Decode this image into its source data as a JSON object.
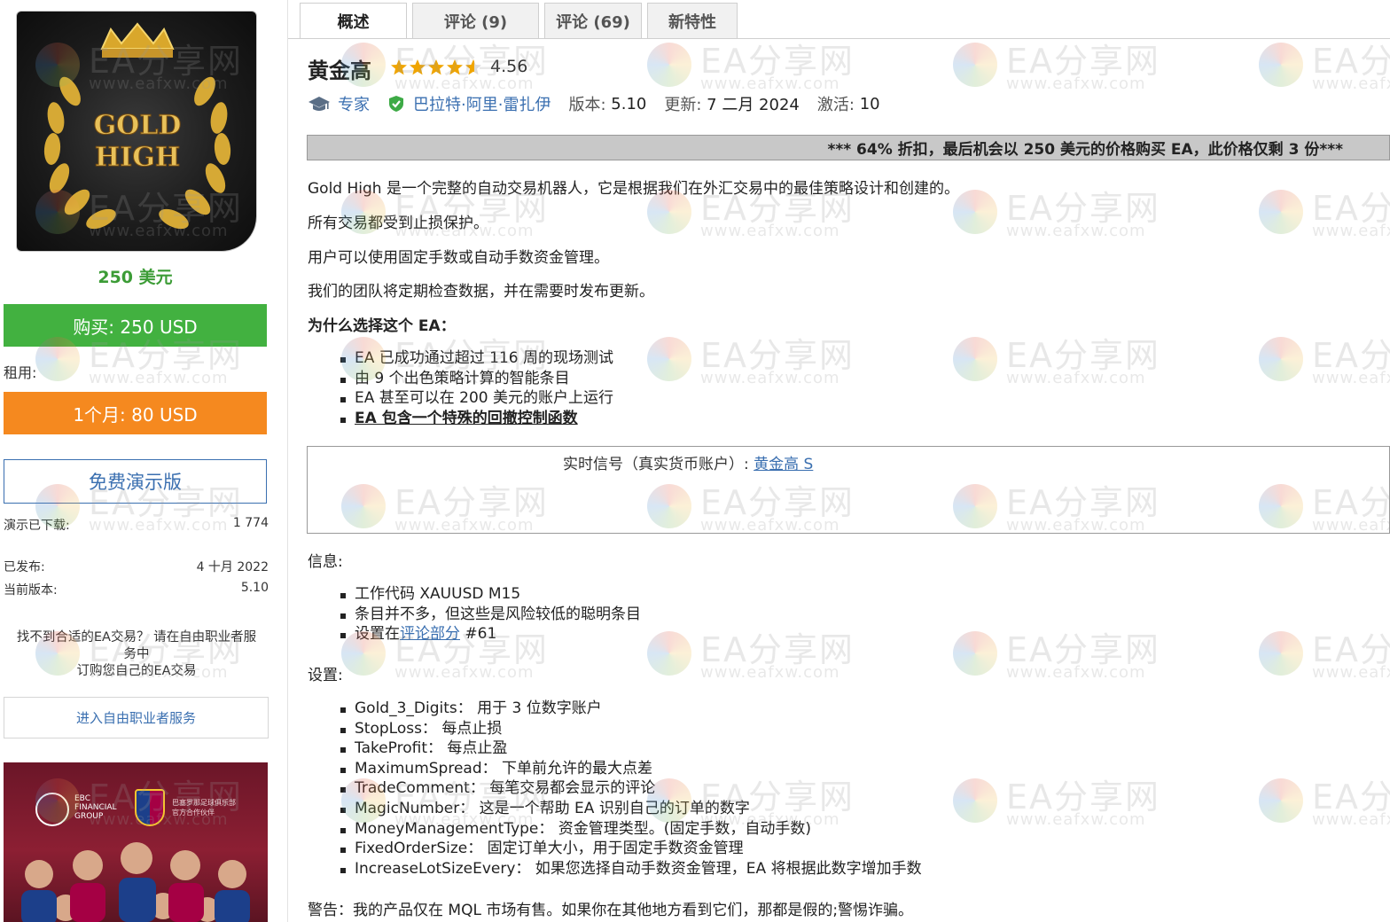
{
  "left": {
    "image_text": [
      "GOLD",
      "HIGH"
    ],
    "price": "250 美元",
    "buy_label": "购买: 250 USD",
    "rent_label": "租用:",
    "rent_button": "1个月: 80 USD",
    "demo_button": "免费演示版",
    "demo_downloads_label": "演示已下载:",
    "demo_downloads_value": "1 774",
    "published_label": "已发布:",
    "published_value": "4 十月 2022",
    "version_label": "当前版本:",
    "version_value": "5.10",
    "freelance_text_1": "找不到合适的EA交易？ 请在自由职业者服",
    "freelance_text_2": "务中",
    "freelance_text_3": "订购您自己的EA交易",
    "freelance_button": "进入自由职业者服务",
    "banner": {
      "ebc_lines": [
        "EBC",
        "FINANCIAL",
        "GROUP"
      ],
      "fcb_lines": [
        "巴塞罗那足球俱乐部",
        "官方合作伙伴"
      ]
    }
  },
  "tabs": [
    {
      "label": "概述",
      "active": true
    },
    {
      "label": "评论 (9)",
      "active": false
    },
    {
      "label": "评论 (69)",
      "active": false
    },
    {
      "label": "新特性",
      "active": false
    }
  ],
  "product": {
    "title": "黄金高",
    "rating": "4.56",
    "rating_value": 4.56,
    "category": "专家",
    "author": "巴拉特·阿里·雷扎伊",
    "version_label": "版本:",
    "version": "5.10",
    "updated_label": "更新:",
    "updated": "7 二月 2024",
    "activations_label": "激活:",
    "activations": "10"
  },
  "promo": "*** 64% 折扣，最后机会以 250 美元的价格购买 EA，此价格仅剩 3 份***",
  "description": {
    "p1": "Gold High 是一个完整的自动交易机器人，它是根据我们在外汇交易中的最佳策略设计和创建的。",
    "p2": "所有交易都受到止损保护。",
    "p3": "用户可以使用固定手数或自动手数资金管理。",
    "p4": "我们的团队将定期检查数据，并在需要时发布更新。",
    "why_heading": "为什么选择这个 EA：",
    "why_items": [
      "EA 已成功通过超过 116 周的现场测试",
      "由 9 个出色策略计算的智能条目",
      "EA 甚至可以在 200 美元的账户上运行",
      "EA 包含一个特殊的回撤控制函数"
    ],
    "signal_label": "实时信号（真实货币账户）:",
    "signal_link": "黄金高 S",
    "info_heading": "信息:",
    "info_items": [
      "工作代码 XAUUSD M15",
      "条目并不多，但这些是风险较低的聪明条目"
    ],
    "info_item3_prefix": "设置在",
    "info_item3_link": "评论部分",
    "info_item3_suffix": " #61",
    "settings_heading": "设置:",
    "settings": [
      "Gold_3_Digits： 用于 3 位数字账户",
      "StopLoss： 每点止损",
      "TakeProfit： 每点止盈",
      "MaximumSpread： 下单前允许的最大点差",
      "TradeComment： 每笔交易都会显示的评论",
      "MagicNumber： 这是一个帮助 EA 识别自己的订单的数字",
      "MoneyManagementType： 资金管理类型。(固定手数，自动手数)",
      "FixedOrderSize： 固定订单大小，用于固定手数资金管理",
      "IncreaseLotSizeEvery： 如果您选择自动手数资金管理，EA 将根据此数字增加手数"
    ],
    "warning": "警告：我的产品仅在 MQL 市场有售。如果你在其他地方看到它们，那都是假的;警惕诈骗。"
  },
  "watermark": {
    "cn": "EA分享网",
    "url": "www.eafxw.com"
  },
  "colors": {
    "buy": "#42b140",
    "rent": "#f5891f",
    "link": "#3a6fb0",
    "price": "#3c9c36",
    "star": "#f0a500"
  }
}
